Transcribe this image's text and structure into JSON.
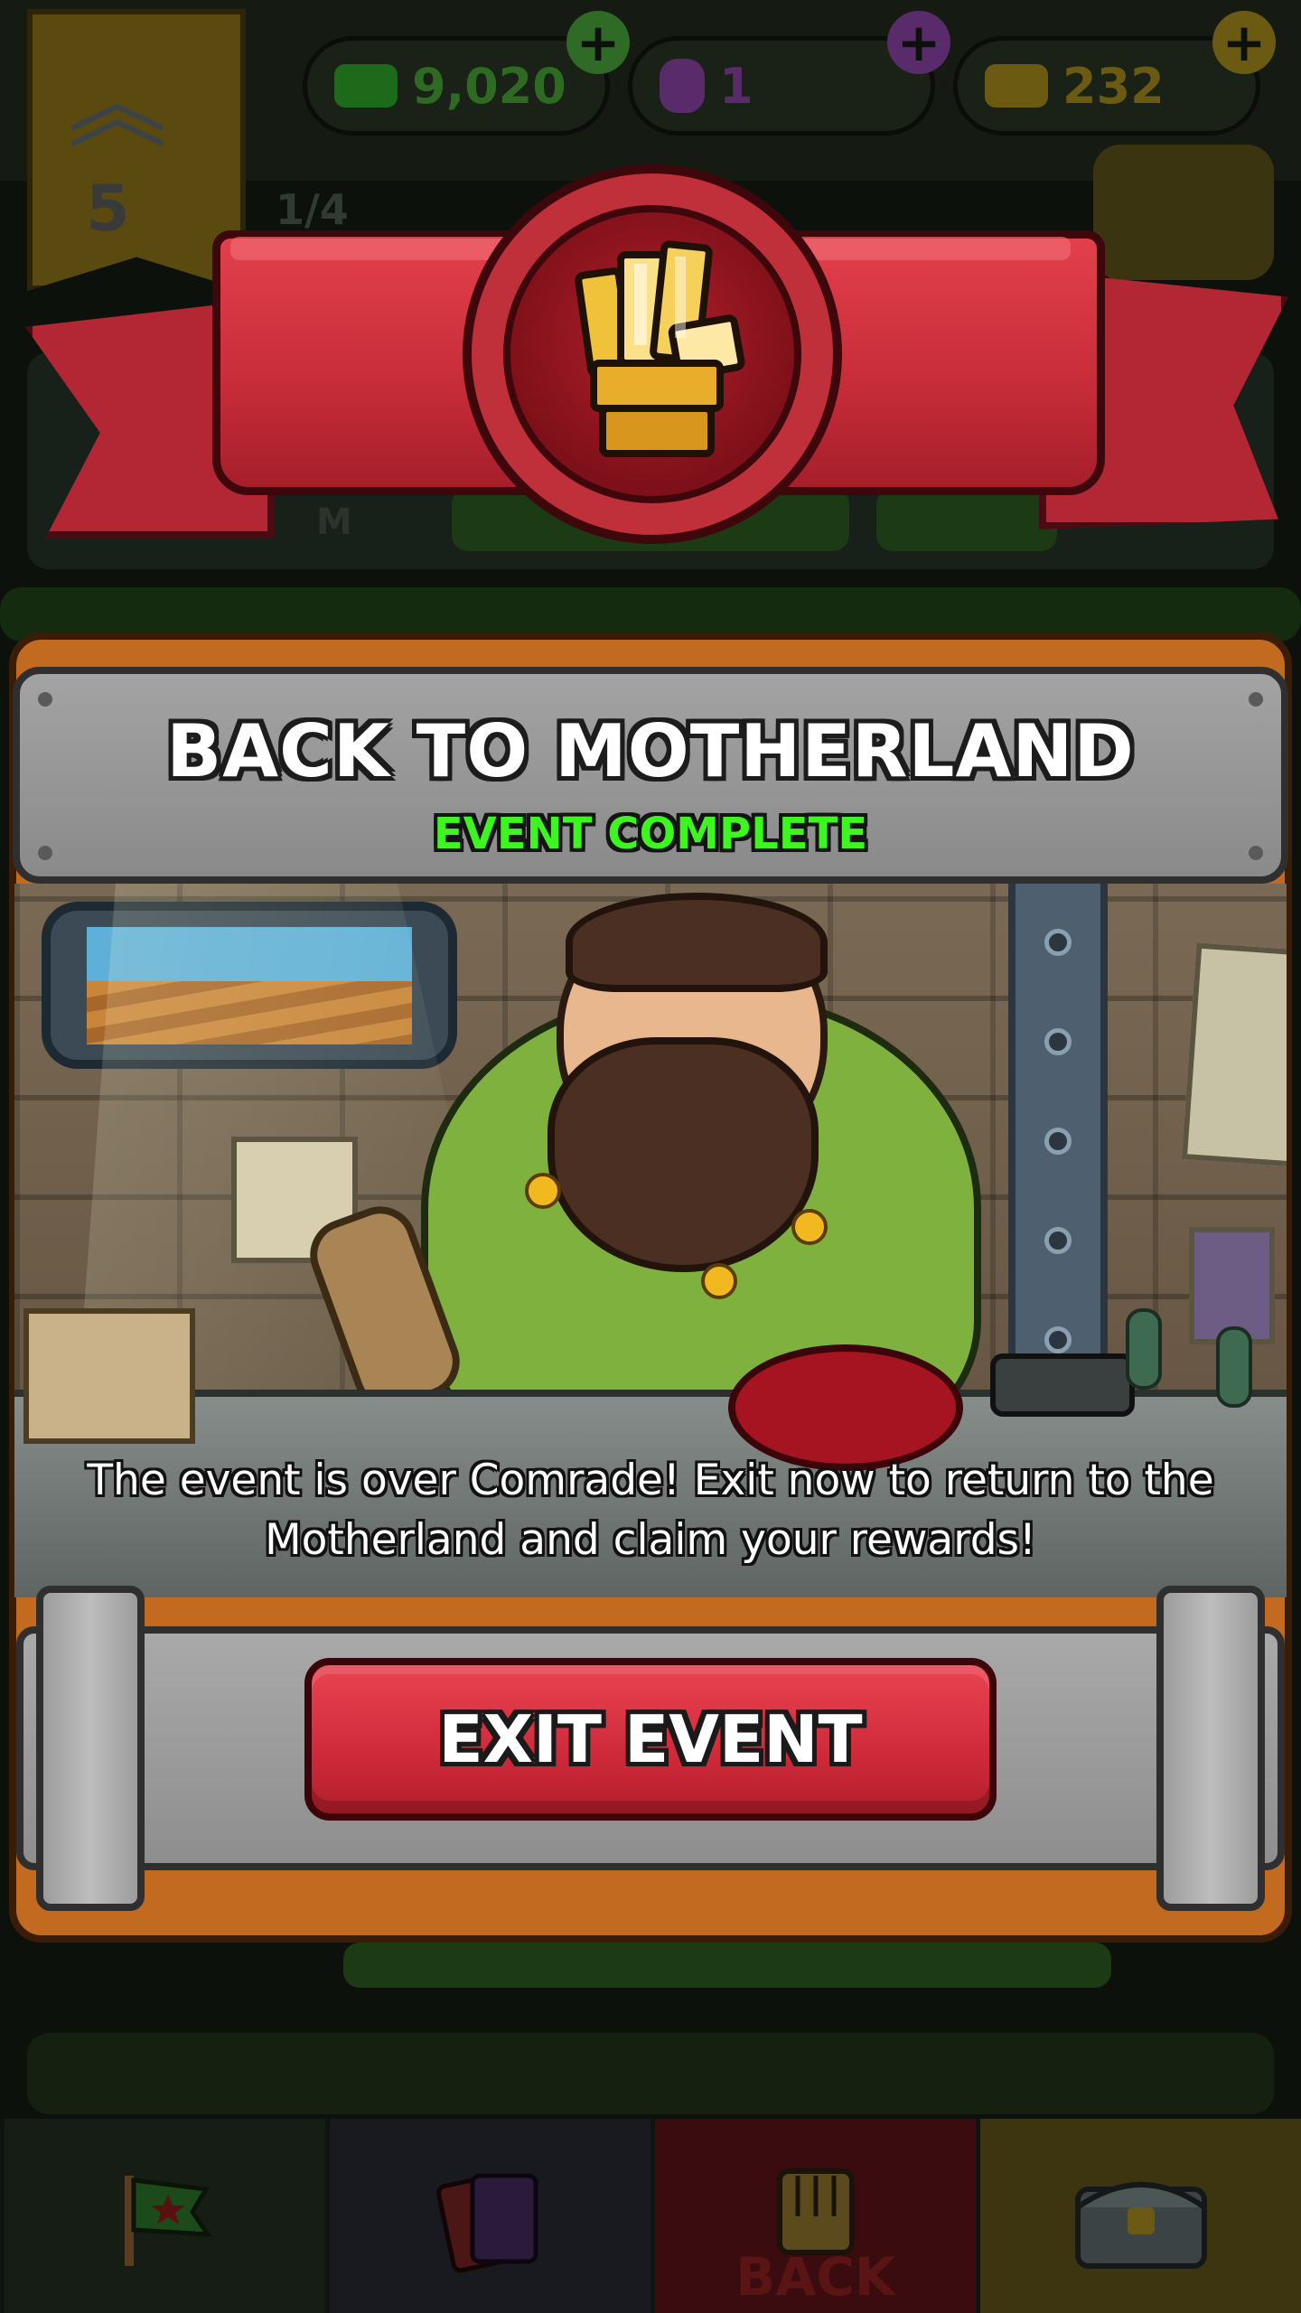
{
  "header": {
    "rank_level": "5",
    "progress_label": "1/4",
    "resources": [
      {
        "icon": "cap-cash-icon",
        "value": "9,020",
        "color": "#1e6a1b"
      },
      {
        "icon": "potion-icon",
        "value": "1",
        "color": "#5a2b6b"
      },
      {
        "icon": "gold-bar-icon",
        "value": "232",
        "color": "#6a5a12"
      }
    ]
  },
  "background": {
    "dim_label": "M"
  },
  "modal": {
    "emblem_icon": "golden-fist-icon",
    "title": "BACK TO MOTHERLAND",
    "subtitle": "EVENT COMPLETE",
    "message_line1": "The event is over Comrade! Exit now to return to the",
    "message_line2": "Motherland and claim your rewards!",
    "exit_button_label": "EXIT EVENT"
  },
  "bottom_nav": {
    "tabs": [
      {
        "name": "map-flag-tab",
        "icon": "flag-star-icon"
      },
      {
        "name": "cards-tab",
        "icon": "cards-icon"
      },
      {
        "name": "back-tab",
        "icon": "fist-icon",
        "label": "BACK"
      },
      {
        "name": "chest-tab",
        "icon": "treasure-chest-icon"
      }
    ]
  },
  "colors": {
    "accent_red": "#d4303f",
    "subtitle_green": "#3df51f",
    "frame_orange": "#c26a1f",
    "plate_gray": "#9a9a9a"
  }
}
